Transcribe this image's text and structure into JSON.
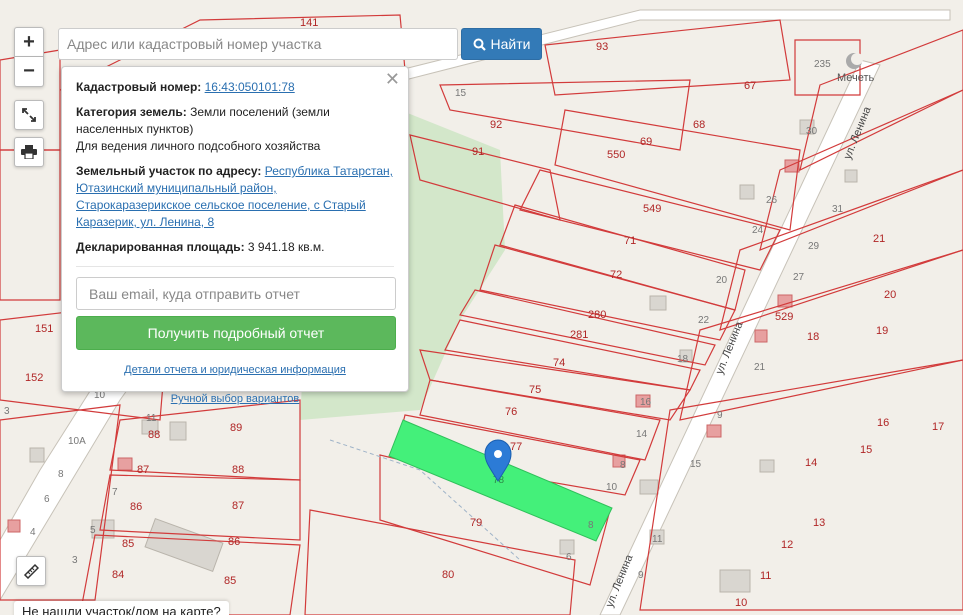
{
  "search": {
    "placeholder": "Адрес или кадастровый номер участка",
    "button_label": "Найти"
  },
  "controls": {
    "zoom_in": "+",
    "zoom_out": "−"
  },
  "popup": {
    "cadastral_label": "Кадастровый номер:",
    "cadastral_number": "16:43:050101:78",
    "category_label": "Категория земель:",
    "category_value": "Земли поселений (земли населенных пунктов)",
    "usage": "Для ведения личного подсобного хозяйства",
    "address_label": "Земельный участок по адресу:",
    "address_value": "Республика Татарстан, Ютазинский муниципальный район, Старокаразерикское сельское поселение, с Старый Каразерик, ул. Ленина, 8",
    "area_label": "Декларированная площадь:",
    "area_value": "3 941.18 кв.м.",
    "email_placeholder": "Ваш email, куда отправить отчет",
    "report_button": "Получить подробный отчет",
    "details_link": "Детали отчета и юридическая информация",
    "manual_link": "Ручной выбор вариантов"
  },
  "map": {
    "street_name": "ул. Ленина",
    "mosque_label": "Мечеть",
    "selected_parcel_label": "78",
    "highlight_color": "#44f07a",
    "parcel_border_color": "#d23b3b",
    "parcel_numbers": [
      "141",
      "93",
      "67",
      "235",
      "30",
      "15",
      "92",
      "91",
      "68",
      "69",
      "550",
      "549",
      "71",
      "72",
      "280",
      "281",
      "74",
      "75",
      "76",
      "77",
      "79",
      "80",
      "26",
      "24",
      "31",
      "29",
      "27",
      "21",
      "20",
      "22",
      "18",
      "529",
      "19",
      "16",
      "17",
      "15",
      "14",
      "13",
      "12",
      "11",
      "10",
      "9",
      "8",
      "6",
      "151",
      "152",
      "11",
      "10А",
      "8",
      "6",
      "4",
      "3",
      "5",
      "7",
      "88",
      "89",
      "87",
      "86",
      "85",
      "84",
      "6",
      "8",
      "10",
      "14",
      "16"
    ],
    "bottom_prompt": "Не нашли участок/дом на карте?"
  }
}
